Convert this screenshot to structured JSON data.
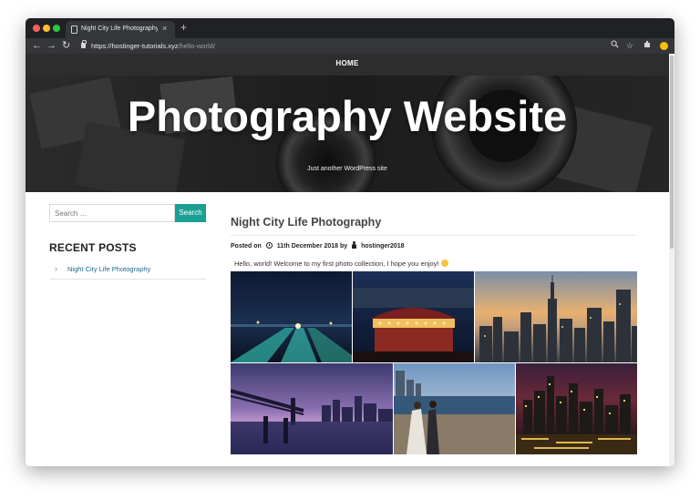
{
  "browser": {
    "tab_title": "Night City Life Photography – Ph",
    "tab_close": "×",
    "new_tab": "+",
    "url_host": "https://hostinger-tutorials.xyz",
    "url_path": "/hello-world/",
    "icons": [
      "back-icon",
      "forward-icon",
      "reload-icon",
      "lock-icon",
      "zoom-icon",
      "star-icon",
      "extension-icon",
      "profile-icon"
    ]
  },
  "site": {
    "nav_home": "HOME",
    "title": "Photography Website",
    "tagline": "Just another WordPress site"
  },
  "sidebar": {
    "search_placeholder": "Search …",
    "search_button": "Search",
    "recent_heading": "RECENT POSTS",
    "recent_chevron": "›",
    "recent_posts": [
      "Night City Life Photography"
    ]
  },
  "post": {
    "title": "Night City Life Photography",
    "posted_on": "Posted on",
    "date": "11th December 2018",
    "by": "by",
    "author": "hostinger2018",
    "excerpt": "Hello, world! Welcome to my first photo collection, I hope you enjoy!",
    "gallery": [
      "night-highway-photo",
      "carousel-photo",
      "city-skyline-sunset-photo",
      "bridge-night-photo",
      "couple-waterfront-photo",
      "city-lights-photo"
    ]
  },
  "colors": {
    "accent": "#1aa093",
    "link": "#1f6b8c",
    "nav_bg": "#2d2d2d",
    "browser_chrome": "#202124"
  }
}
